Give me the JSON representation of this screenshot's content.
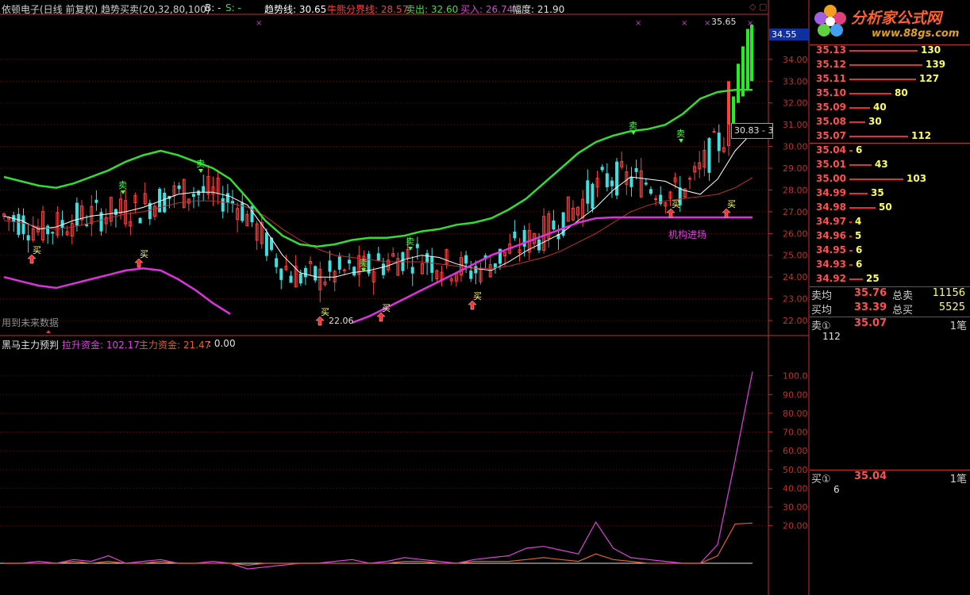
{
  "header": {
    "title": "依顿电子(日线 前复权) 趋势买卖(20,32,80,100)",
    "b_label": "B: -",
    "s_label": "S: -",
    "trend_label": "趋势线:",
    "trend_value": "30.65",
    "bullbear_label": "牛熊分界线:",
    "bullbear_value": "28.57",
    "sell_label": "卖出:",
    "sell_value": "32.60",
    "buy_label": "买入:",
    "buy_value": "26.74",
    "range_label": "幅度:",
    "range_value": "21.90"
  },
  "sub_header": {
    "title": "黑马主力预判",
    "lift_label": "拉升资金:",
    "lift_value": "102.17",
    "main_label": "主力资金:",
    "main_value": "21.47",
    "zero_value": ": 0.00"
  },
  "annotations": {
    "future_data": "用到未来数据",
    "low_price": "22.06",
    "high_price": "35.65",
    "institution": "机构进场",
    "current_price_box": "30.83 - 3",
    "last_price_tag": "34.55",
    "buy_marker": "买",
    "sell_marker": "卖"
  },
  "colors": {
    "upper_band": "#33dd33",
    "lower_band": "#dd33dd",
    "trend_line": "#ffffff",
    "bullbear_line": "#c03030",
    "up_candle": "#ff4040",
    "down_candle": "#40e0e0",
    "lift_fund": "#dd44dd",
    "main_fund": "#e06030"
  },
  "chart_data": [
    {
      "type": "candlestick",
      "ylim": [
        21.6,
        35.6
      ],
      "y_ticks": [
        "34.00",
        "33.00",
        "32.00",
        "31.00",
        "30.00",
        "29.00",
        "28.00",
        "27.00",
        "26.00",
        "25.00",
        "24.00",
        "23.00",
        "22.00"
      ],
      "series": [
        {
          "name": "趋势线",
          "values": [
            26.8,
            26.6,
            26.2,
            26.3,
            26.6,
            26.8,
            26.9,
            27.0,
            27.2,
            27.5,
            27.8,
            27.9,
            27.9,
            27.7,
            27.3,
            26.2,
            25.0,
            24.2,
            24.0,
            24.0,
            24.2,
            24.3,
            24.5,
            24.8,
            25.0,
            24.9,
            24.6,
            24.4,
            24.3,
            24.7,
            25.2,
            25.6,
            26.0,
            26.6,
            27.2,
            28.0,
            28.6,
            28.5,
            28.4,
            28.0,
            27.8,
            28.5,
            29.8,
            30.65
          ]
        },
        {
          "name": "牛熊分界线",
          "values": [
            26.6,
            26.5,
            26.3,
            26.2,
            26.3,
            26.5,
            26.7,
            26.9,
            27.0,
            27.2,
            27.4,
            27.5,
            27.5,
            27.4,
            27.2,
            26.8,
            26.2,
            25.7,
            25.3,
            25.0,
            24.9,
            24.8,
            24.7,
            24.7,
            24.7,
            24.6,
            24.5,
            24.4,
            24.4,
            24.5,
            24.7,
            24.9,
            25.2,
            25.6,
            26.0,
            26.5,
            27.0,
            27.3,
            27.5,
            27.6,
            27.7,
            27.8,
            28.1,
            28.57
          ]
        },
        {
          "name": "卖出",
          "values": [
            28.6,
            28.4,
            28.2,
            28.1,
            28.3,
            28.6,
            28.9,
            29.3,
            29.6,
            29.8,
            29.6,
            29.3,
            29.0,
            28.5,
            27.6,
            26.6,
            25.9,
            25.5,
            25.4,
            25.5,
            25.7,
            25.8,
            25.8,
            25.9,
            26.1,
            26.2,
            26.4,
            26.5,
            26.7,
            27.1,
            27.6,
            28.3,
            29.0,
            29.7,
            30.2,
            30.5,
            30.7,
            30.8,
            31.0,
            31.5,
            32.2,
            32.5,
            32.6,
            32.6
          ]
        },
        {
          "name": "买入",
          "values": [
            24.0,
            23.8,
            23.6,
            23.5,
            23.7,
            23.9,
            24.1,
            24.3,
            24.4,
            24.3,
            23.9,
            23.4,
            22.8,
            22.3,
            null,
            null,
            null,
            null,
            null,
            null,
            21.9,
            22.2,
            22.6,
            23.0,
            23.4,
            23.8,
            24.2,
            24.6,
            25.0,
            25.3,
            25.6,
            25.9,
            26.2,
            26.5,
            26.7,
            26.74,
            26.74,
            26.74,
            26.74,
            26.74,
            26.74,
            26.74,
            26.74,
            26.74
          ]
        }
      ],
      "key_prices": {
        "low": 22.06,
        "high": 35.65,
        "last": 34.55
      }
    },
    {
      "type": "line",
      "ylim": [
        0,
        110
      ],
      "y_ticks": [
        "100.0",
        "90.00",
        "80.00",
        "70.00",
        "60.00",
        "50.00",
        "40.00",
        "30.00",
        "20.00"
      ],
      "series": [
        {
          "name": "拉升资金",
          "values": [
            0,
            0,
            1,
            0,
            2,
            1,
            4,
            0,
            1,
            2,
            0,
            0,
            1,
            0,
            -3,
            -2,
            -1,
            0,
            0,
            1,
            2,
            0,
            1,
            3,
            2,
            1,
            0,
            2,
            3,
            4,
            8,
            9,
            7,
            5,
            22,
            8,
            3,
            2,
            1,
            0,
            0,
            10,
            55,
            102.17
          ]
        },
        {
          "name": "主力资金",
          "values": [
            0,
            0,
            0,
            0,
            1,
            0,
            1,
            0,
            0,
            1,
            0,
            0,
            0,
            0,
            -1,
            0,
            0,
            0,
            0,
            0,
            0,
            0,
            0,
            1,
            1,
            0,
            0,
            1,
            1,
            1,
            2,
            3,
            2,
            1,
            5,
            2,
            1,
            0,
            0,
            0,
            0,
            4,
            21,
            21.47
          ]
        }
      ]
    }
  ],
  "order_book": {
    "asks": [
      {
        "price": "35.13",
        "vol": "130"
      },
      {
        "price": "35.12",
        "vol": "139"
      },
      {
        "price": "35.11",
        "vol": "127"
      },
      {
        "price": "35.10",
        "vol": "80"
      },
      {
        "price": "35.09",
        "vol": "40"
      },
      {
        "price": "35.08",
        "vol": "30"
      },
      {
        "price": "35.07",
        "vol": "112"
      }
    ],
    "bids": [
      {
        "price": "35.04",
        "vol": "6"
      },
      {
        "price": "35.01",
        "vol": "43"
      },
      {
        "price": "35.00",
        "vol": "103"
      },
      {
        "price": "34.99",
        "vol": "35"
      },
      {
        "price": "34.98",
        "vol": "50"
      },
      {
        "price": "34.97",
        "vol": "4"
      },
      {
        "price": "34.96",
        "vol": "5"
      },
      {
        "price": "34.95",
        "vol": "6"
      },
      {
        "price": "34.93",
        "vol": "6"
      },
      {
        "price": "34.92",
        "vol": "25"
      }
    ],
    "sell_avg_label": "卖均",
    "sell_avg": "35.76",
    "sell_total_label": "总卖",
    "sell_total": "11156",
    "buy_avg_label": "买均",
    "buy_avg": "33.39",
    "buy_total_label": "总买",
    "buy_total": "5525",
    "ask1_label": "卖①",
    "ask1_price": "35.07",
    "ask1_unit": "1笔",
    "ask1_qty": "112",
    "bid1_label": "买①",
    "bid1_price": "35.04",
    "bid1_unit": "1笔",
    "bid1_qty": "6"
  },
  "logo": {
    "text": "分析家公式网",
    "url": "www.88gs.com"
  }
}
